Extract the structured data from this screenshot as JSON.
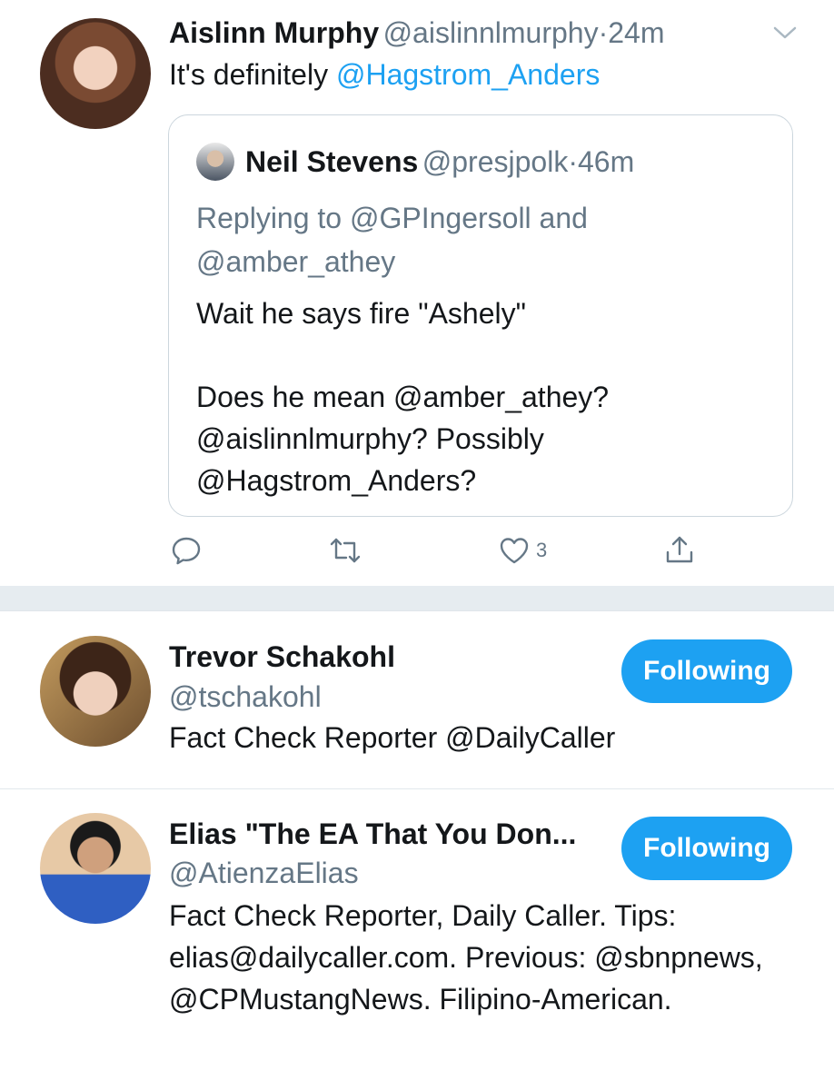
{
  "tweet": {
    "author_name": "Aislinn Murphy",
    "author_handle": "@aislinnlmurphy",
    "time": "24m",
    "text_prefix": "It's definitely ",
    "text_mention": "@Hagstrom_Anders",
    "quoted": {
      "author_name": "Neil Stevens",
      "author_handle": "@presjpolk",
      "time": "46m",
      "replying_to": "Replying to @GPIngersoll and @amber_athey",
      "body_line1": "Wait he says fire \"Ashely\"",
      "body_line2": "Does he mean @amber_athey?",
      "body_line3": "@aislinnlmurphy?  Possibly",
      "body_line4": "@Hagstrom_Anders?"
    },
    "actions": {
      "reply_icon": "reply-icon",
      "retweet_icon": "retweet-icon",
      "like_icon": "heart-icon",
      "like_count": "3",
      "share_icon": "share-icon"
    }
  },
  "users": [
    {
      "name": "Trevor Schakohl",
      "handle": "@tschakohl",
      "bio": "Fact Check Reporter @DailyCaller",
      "button": "Following"
    },
    {
      "name": "Elias \"The EA That You Don...",
      "handle": "@AtienzaElias",
      "bio": "Fact Check Reporter, Daily Caller. Tips: elias@dailycaller.com. Previous: @sbnpnews, @CPMustangNews. Filipino-American.",
      "button": "Following"
    }
  ],
  "colors": {
    "accent": "#1da1f2",
    "secondary_text": "#657786",
    "divider": "#e6ecf0"
  }
}
